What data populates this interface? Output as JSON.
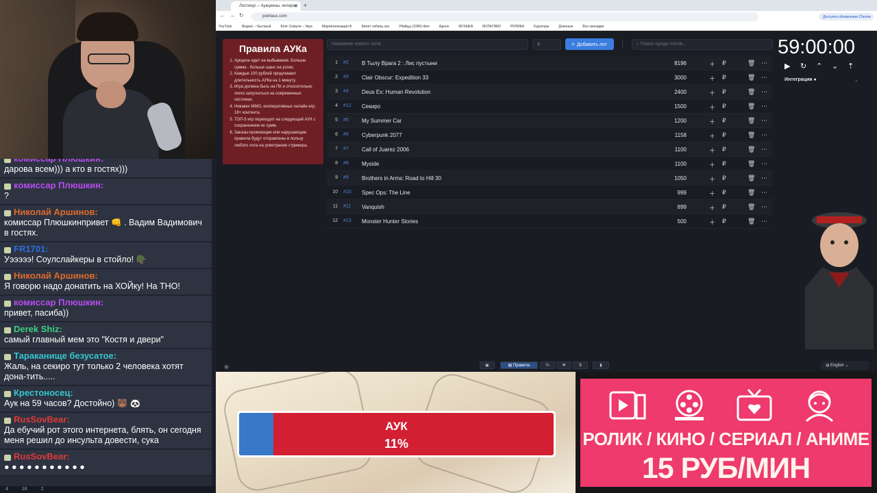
{
  "chat": {
    "messages": [
      {
        "author": "комиссар Плюшкин:",
        "color": "#b84cf0",
        "text": "дарова всем))) а кто в гостях)))"
      },
      {
        "author": "комиссар Плюшкин:",
        "color": "#b84cf0",
        "text": "?"
      },
      {
        "author": "Николай Аршинов:",
        "color": "#e06a2c",
        "text": "комиссар Плюшкинпривет 👊 . Вадим Вадимович в гостях."
      },
      {
        "author": "FR1701:",
        "color": "#2b6ee0",
        "text": "Уэээээ! Соулслайкеры в стойло! 🪖"
      },
      {
        "author": "Николай Аршинов:",
        "color": "#e06a2c",
        "text": "Я говорю надо донатить на ХОЙку! На ТНО!"
      },
      {
        "author": "комиссар Плюшкин:",
        "color": "#b84cf0",
        "text": "привет, пасиба))"
      },
      {
        "author": "Derek Shiz:",
        "color": "#3fcf82",
        "text": "самый главный мем это \"Костя и двери\""
      },
      {
        "author": "Тараканище безусатое:",
        "color": "#37c7cf",
        "text": "Жаль, на секиро тут только 2 человека хотят дона-тить....."
      },
      {
        "author": "Крестоносец:",
        "color": "#37c7cf",
        "text": "Аук на 59 часов? Достойно) 🐻 🐼"
      },
      {
        "author": "RusSovBear:",
        "color": "#e03a3a",
        "text": "Да ебучий рот этого интернета, блять, он сегодня меня решил до инсульта довести, сука"
      },
      {
        "author": "RusSovBear:",
        "color": "#e03a3a",
        "text": "● ● ● ● ● ● ● ● ● ● ●"
      }
    ],
    "footer": [
      "4",
      "18",
      "2"
    ]
  },
  "browser": {
    "tab_title": "Лостикус – Аукционы, интерак",
    "url": "pointauc.com",
    "update_label": "Доступно обновление Chrome",
    "bookmarks": [
      "YouTube",
      "Яндекс – быстрый",
      "Блог Семуля – Укра",
      "Маргинализация Б",
      "Билет таблиц ска",
      "Убийцы (1996) Фил",
      "Адоно",
      "МУЗЫКА",
      "МУЛЬТИКИ",
      "РОЛИКИ",
      "Кураторы",
      "Длинные",
      "Все закладки"
    ]
  },
  "rules": {
    "title": "Правила АУКа",
    "items": [
      "Аукцион идет на выбывание. Больше сумма - больше шанс на успех.",
      "Каждые 100 рублей продлевают длительность АУКа на 1 минуту.",
      "Игра должна быть на ПК и относительно легко запускаться на современных системах.",
      "Никаких MMO, кооперативных онлайн игр, 18+ контента.",
      "ТОП-5 игр переходят на следующий АУК с сохранением их сумм.",
      "Заказы-провокации или нарушающие правила будут отправлены в пользу любого лота на усмотрение стримера."
    ]
  },
  "controls": {
    "lot_placeholder": "Название нового лота",
    "sum_placeholder": "₽",
    "add_label": "Добавить лот",
    "search_placeholder": "Поиск среди лотов..."
  },
  "lots": [
    {
      "num": "1",
      "id": "#2",
      "name": "В Тылу Врага 2 : Лис пустыни",
      "amount": "8196"
    },
    {
      "num": "2",
      "id": "#3",
      "name": "Clair Obscur: Expedition 33",
      "amount": "3000"
    },
    {
      "num": "3",
      "id": "#4",
      "name": "Deus Ex: Human Revolution",
      "amount": "2400"
    },
    {
      "num": "4",
      "id": "#12",
      "name": "Секиро",
      "amount": "1500"
    },
    {
      "num": "5",
      "id": "#5",
      "name": "My Summer Car",
      "amount": "1200"
    },
    {
      "num": "6",
      "id": "#6",
      "name": "Cyberpunk 2077",
      "amount": "1158"
    },
    {
      "num": "7",
      "id": "#7",
      "name": "Call of Juarez 2006",
      "amount": "1100"
    },
    {
      "num": "8",
      "id": "#8",
      "name": "Myside",
      "amount": "1100"
    },
    {
      "num": "9",
      "id": "#9",
      "name": "Brothers in Arms: Road to Hill 30",
      "amount": "1050"
    },
    {
      "num": "10",
      "id": "#10",
      "name": "Spec Ops: The Line",
      "amount": "999"
    },
    {
      "num": "11",
      "id": "#11",
      "name": "Vanquish",
      "amount": "899"
    },
    {
      "num": "12",
      "id": "#13",
      "name": "Monster Hunter Stories",
      "amount": "500"
    }
  ],
  "timer": {
    "value": "59:00:00",
    "integrations_label": "Интеграции"
  },
  "bottom": {
    "rules_btn": "Правила",
    "language": "English"
  },
  "auk_bar": {
    "label": "АУК",
    "percent_text": "11%",
    "fill_fraction": 0.11
  },
  "promo": {
    "line1": "РОЛИК / КИНО / СЕРИАЛ / АНИМЕ",
    "line2": "15 РУБ/МИН"
  },
  "colors": {
    "accent": "#3b7de0",
    "rules_bg": "#6e1f24",
    "promo_bg": "#ee3a6c",
    "auk_red": "#d21f32",
    "auk_blue": "#3878c8"
  }
}
